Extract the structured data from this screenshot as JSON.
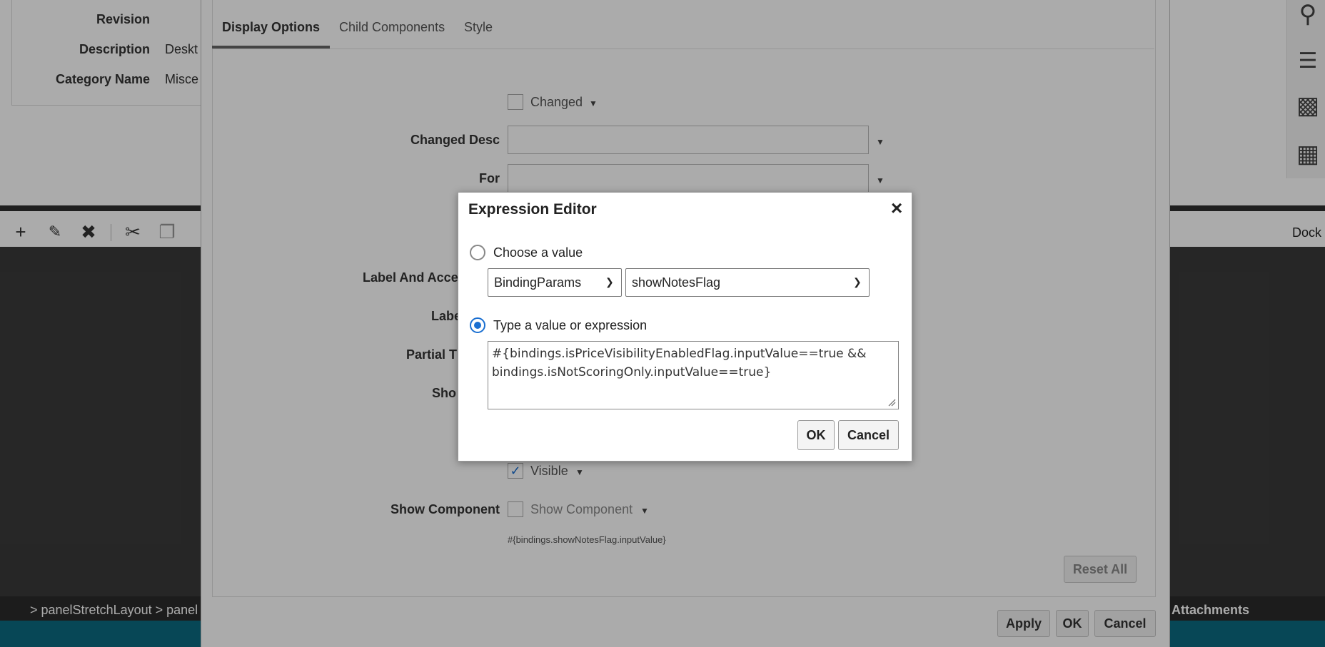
{
  "background": {
    "meta": {
      "revision_label": "Revision",
      "description_label": "Description",
      "description_value": "Deskt",
      "category_label": "Category Name",
      "category_value": "Misce"
    },
    "toolbar_icons": [
      "plus-icon",
      "edit-icon",
      "delete-icon",
      "cut-icon",
      "copy-icon"
    ],
    "dock_label": "Dock",
    "breadcrumb": "> panelStretchLayout > panel",
    "attachments_label": "Attachments"
  },
  "properties_dialog": {
    "tabs": [
      {
        "label": "Display Options",
        "active": true
      },
      {
        "label": "Child Components",
        "active": false
      },
      {
        "label": "Style",
        "active": false
      }
    ],
    "changed_checkbox_label": "Changed",
    "changed_desc_label": "Changed Desc",
    "for_label": "For",
    "label_and_access_label": "Label And Acce",
    "label_label": "Labe",
    "partial_label": "Partial T",
    "show_label": "Sho",
    "visible_label": "Visible",
    "visible_checked": true,
    "show_component_label": "Show Component",
    "show_component_checkbox_label": "Show Component",
    "show_component_expression": "#{bindings.showNotesFlag.inputValue}",
    "reset_all_label": "Reset All",
    "apply_label": "Apply",
    "ok_label": "OK",
    "cancel_label": "Cancel"
  },
  "expression_editor": {
    "title": "Expression Editor",
    "choose_value_label": "Choose a value",
    "choose_value_selected": false,
    "binding_select": "BindingParams",
    "attribute_select": "showNotesFlag",
    "type_expression_label": "Type a value or expression",
    "type_expression_selected": true,
    "expression_text": "#{bindings.isPriceVisibilityEnabledFlag.inputValue==true && bindings.isNotScoringOnly.inputValue==true}",
    "ok_label": "OK",
    "cancel_label": "Cancel",
    "accent_color": "#1a6fd1"
  }
}
